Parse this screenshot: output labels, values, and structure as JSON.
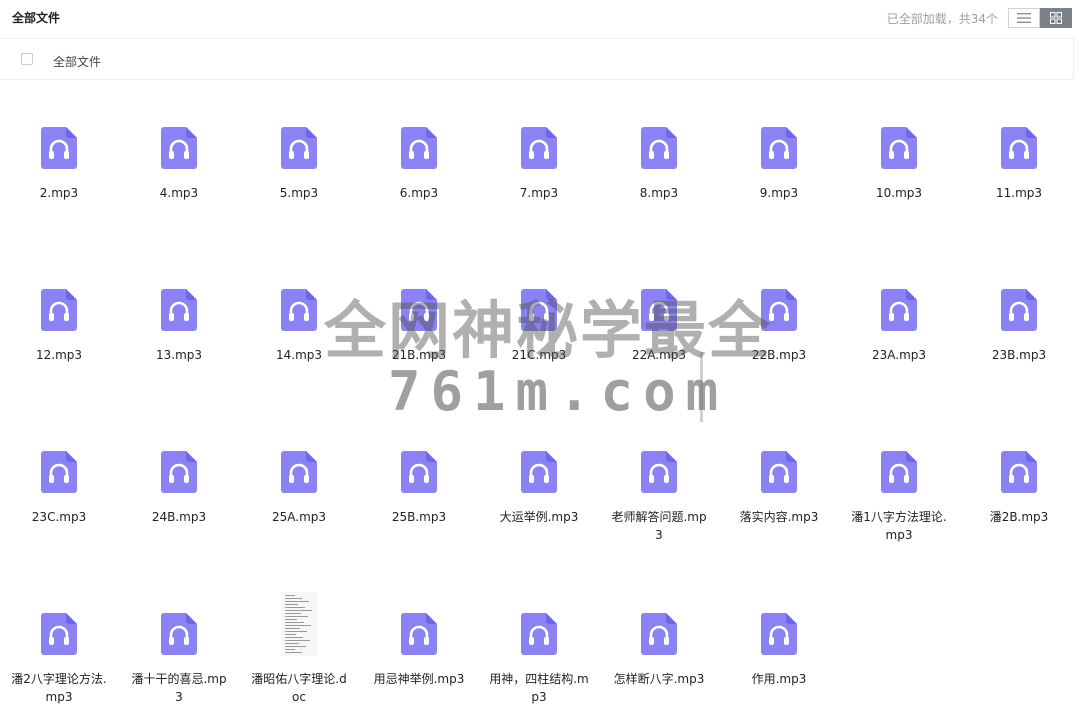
{
  "header": {
    "title": "全部文件",
    "status": "已全部加载，共34个",
    "view_icons": [
      "list-view-icon",
      "grid-view-icon"
    ]
  },
  "breadcrumb": {
    "label": "全部文件"
  },
  "colors": {
    "audio_icon": "#8b83f4",
    "audio_icon_dark": "#6e66e6",
    "active_toggle": "#7d8288"
  },
  "files": [
    {
      "name": "2.mp3",
      "type": "audio"
    },
    {
      "name": "4.mp3",
      "type": "audio"
    },
    {
      "name": "5.mp3",
      "type": "audio"
    },
    {
      "name": "6.mp3",
      "type": "audio"
    },
    {
      "name": "7.mp3",
      "type": "audio"
    },
    {
      "name": "8.mp3",
      "type": "audio"
    },
    {
      "name": "9.mp3",
      "type": "audio"
    },
    {
      "name": "10.mp3",
      "type": "audio"
    },
    {
      "name": "11.mp3",
      "type": "audio"
    },
    {
      "name": "12.mp3",
      "type": "audio"
    },
    {
      "name": "13.mp3",
      "type": "audio"
    },
    {
      "name": "14.mp3",
      "type": "audio"
    },
    {
      "name": "21B.mp3",
      "type": "audio"
    },
    {
      "name": "21C.mp3",
      "type": "audio"
    },
    {
      "name": "22A.mp3",
      "type": "audio"
    },
    {
      "name": "22B.mp3",
      "type": "audio"
    },
    {
      "name": "23A.mp3",
      "type": "audio"
    },
    {
      "name": "23B.mp3",
      "type": "audio"
    },
    {
      "name": "23C.mp3",
      "type": "audio"
    },
    {
      "name": "24B.mp3",
      "type": "audio"
    },
    {
      "name": "25A.mp3",
      "type": "audio"
    },
    {
      "name": "25B.mp3",
      "type": "audio"
    },
    {
      "name": "大运举例.mp3",
      "type": "audio"
    },
    {
      "name": "老师解答问题.mp3",
      "type": "audio"
    },
    {
      "name": "落实内容.mp3",
      "type": "audio"
    },
    {
      "name": "潘1八字方法理论.mp3",
      "type": "audio"
    },
    {
      "name": "潘2B.mp3",
      "type": "audio"
    },
    {
      "name": "潘2八字理论方法.mp3",
      "type": "audio"
    },
    {
      "name": "潘十干的喜忌.mp3",
      "type": "audio"
    },
    {
      "name": "潘昭佑八字理论.doc",
      "type": "doc"
    },
    {
      "name": "用忌神举例.mp3",
      "type": "audio"
    },
    {
      "name": "用神，四柱结构.mp3",
      "type": "audio"
    },
    {
      "name": "怎样断八字.mp3",
      "type": "audio"
    },
    {
      "name": "作用.mp3",
      "type": "audio"
    }
  ],
  "watermark": {
    "line1": "全网神秘学最全",
    "line2": "761m.com"
  }
}
